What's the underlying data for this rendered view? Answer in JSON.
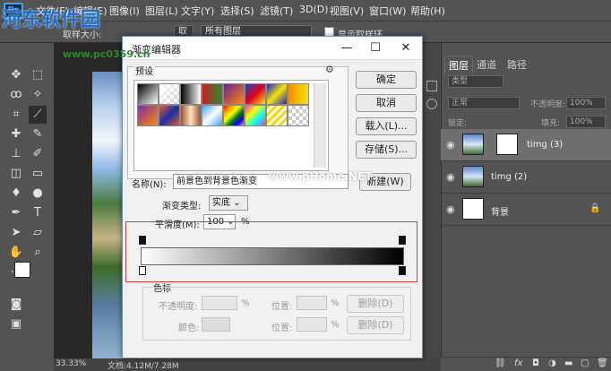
{
  "menubar": {
    "logo": "Ps",
    "items": [
      "文件(F)",
      "编辑(E)",
      "图像(I)",
      "图层(L)",
      "文字(Y)",
      "选择(S)",
      "滤镜(T)",
      "3D(D)",
      "视图(V)",
      "窗口(W)",
      "帮助(H)"
    ]
  },
  "optbar": {
    "sample_label": "取样大小:",
    "sample_value": "取样点",
    "layer_value": "所有图层",
    "ring_label": "显示取样环"
  },
  "watermark": {
    "site": "河东软件园",
    "url": "www.pc0359.cn"
  },
  "status": {
    "zoom": "33.33%",
    "doc": "文档:4.12M/7.28M"
  },
  "dialog": {
    "title": "渐变编辑器",
    "presets_label": "预设",
    "buttons": {
      "ok": "确定",
      "cancel": "取消",
      "load": "载入(L)...",
      "save": "存储(S)...",
      "new": "新建(W)"
    },
    "name_label": "名称(N):",
    "name_value": "前景色到背景色渐变",
    "type_label": "渐变类型:",
    "type_value": "实底",
    "smooth_label": "平滑度(M):",
    "smooth_value": "100",
    "smooth_unit": "%",
    "stops_label": "色标",
    "opacity_label": "不透明度:",
    "color_label": "颜色:",
    "location_label": "位置:",
    "percent": "%",
    "delete_label": "删除(D)",
    "gear_icon": "gear-icon",
    "watermark": "www.pHome.NET"
  },
  "swatch_colors": [
    [
      "#000000",
      "#ffffff",
      "#888888",
      "#c81e1e",
      "#6a1f9a",
      "#1f3fb5",
      "#ff8a00",
      "#f2e600",
      "#f5f5f5"
    ],
    [
      "#7a2fb0",
      "#e25a1a",
      "#a0522d",
      "#3da0ff",
      "#f03cb4",
      "#1aa8e0",
      "#ffd400",
      "#cccccc",
      "#dddddd"
    ]
  ],
  "layers": {
    "tabs": [
      "图层",
      "通道",
      "路径"
    ],
    "filter_value": "类型",
    "mode_value": "正常",
    "opacity_label": "不透明度:",
    "opacity_value": "100%",
    "lock_label": "锁定:",
    "fill_label": "填充:",
    "fill_value": "100%",
    "items": [
      {
        "name": "timg (3)",
        "selected": true
      },
      {
        "name": "timg (2)",
        "selected": false
      },
      {
        "name": "背景",
        "selected": false
      }
    ],
    "bottom_icons": [
      "link-icon",
      "fx-icon",
      "mask-icon",
      "adjustment-icon",
      "folder-icon",
      "new-layer-icon",
      "trash-icon"
    ]
  },
  "colors": {
    "accent": "#31a8ff",
    "highlight_box": "#e03b3b",
    "selected_layer": "#6f6f6f"
  }
}
